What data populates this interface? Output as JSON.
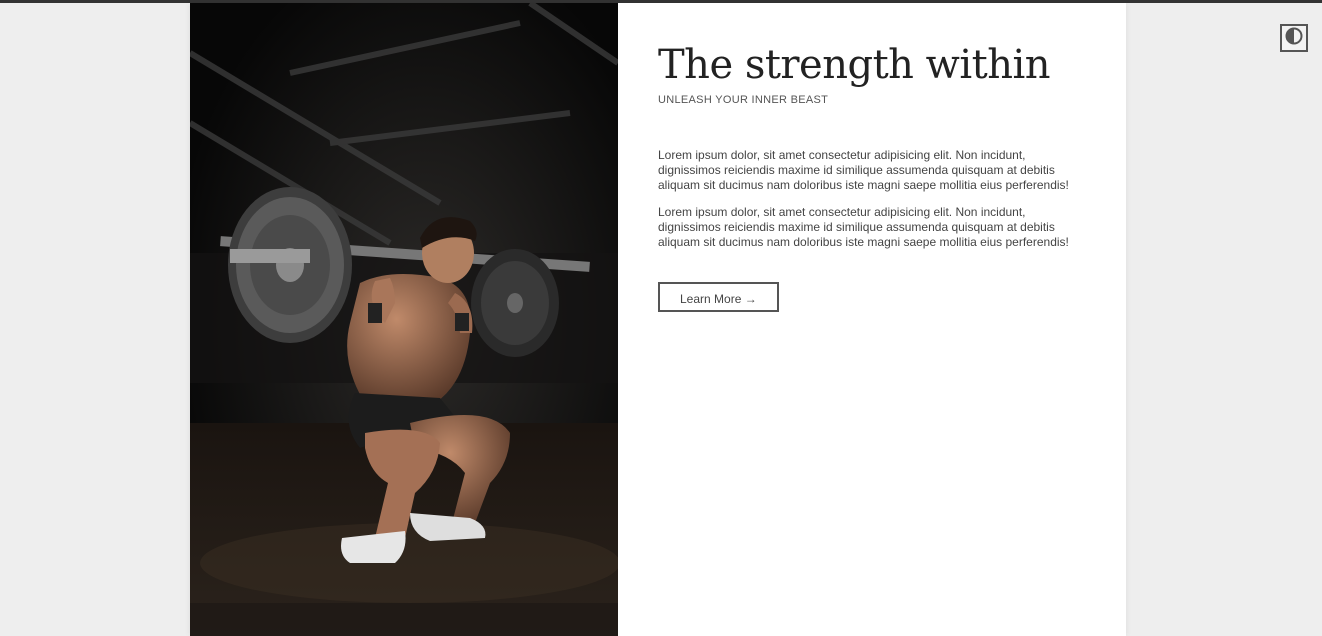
{
  "hero": {
    "title": "The strength within",
    "subtitle": "UNLEASH YOUR INNER BEAST",
    "paragraphs": [
      "Lorem ipsum dolor, sit amet consectetur adipisicing elit. Non incidunt, dignissimos reiciendis maxime id similique assumenda quisquam at debitis aliquam sit ducimus nam doloribus iste magni saepe mollitia eius perferendis!",
      "Lorem ipsum dolor, sit amet consectetur adipisicing elit. Non incidunt, dignissimos reiciendis maxime id similique assumenda quisquam at debitis aliquam sit ducimus nam doloribus iste magni saepe mollitia eius perferendis!"
    ],
    "button_label": "Learn More →",
    "image_icon": "barbell-squat-photo"
  },
  "theme_toggle": {
    "icon": "contrast-icon"
  },
  "colors": {
    "page_bg": "#eeeeee",
    "card_bg": "#ffffff",
    "text_dark": "#222222",
    "border": "#555555"
  }
}
